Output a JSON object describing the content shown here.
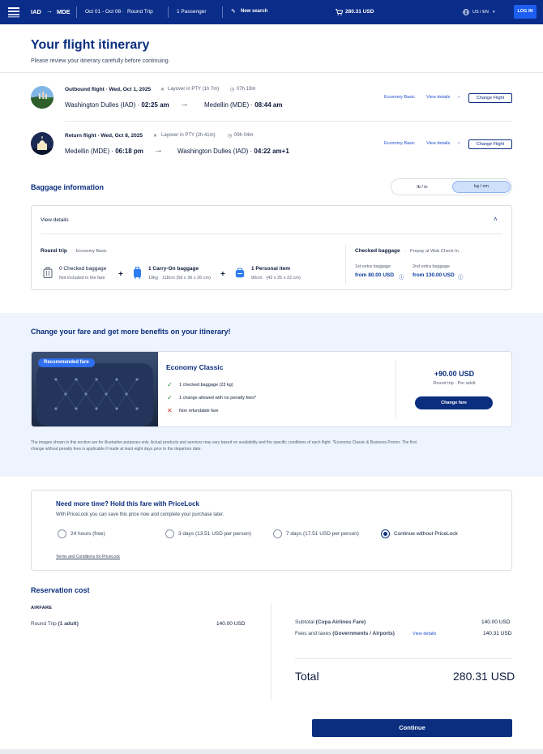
{
  "header": {
    "origin": "IAD",
    "destination": "MDE",
    "dates": "Oct 01 - Oct 08",
    "trip_type": "Round Trip",
    "passengers": "1 Passenger",
    "new_search": "New search",
    "cart_total": "280.31 USD",
    "locale": "US / EN",
    "login": "LOG IN"
  },
  "page": {
    "title": "Your flight itinerary",
    "subtitle": "Please review your itinerary carefully before continuing."
  },
  "flights": [
    {
      "label": "Outbound flight · Wed, Oct 1, 2025",
      "layover": "Layover in PTY (1h 7m)",
      "duration": "07h 19m",
      "from": "Washington Dulles (IAD)",
      "from_time": "02:25 am",
      "to": "Medellin (MDE)",
      "to_time": "08:44 am",
      "fare": "Economy Basic",
      "view_details": "View details",
      "change": "Change Flight"
    },
    {
      "label": "Return flight · Wed, Oct 8, 2025",
      "layover": "Layover in PTY (2h 41m)",
      "duration": "09h 04m",
      "from": "Medellin (MDE)",
      "from_time": "06:18 pm",
      "to": "Washington Dulles (IAD)",
      "to_time": "04:22 am+1",
      "fare": "Economy Basic",
      "view_details": "View details",
      "change": "Change Flight"
    }
  ],
  "baggage": {
    "title": "Baggage information",
    "unit_lb": "lb / in",
    "unit_kg": "kg / cm",
    "view_details": "View details",
    "round_trip": "Round trip",
    "round_trip_fare": "Economy Basic",
    "items": [
      {
        "title": "0 Checked baggage",
        "detail": "Not included in the fare"
      },
      {
        "title": "1 Carry-On baggage",
        "detail": "10kg · 118cm (56 x 36 x 26 cm)"
      },
      {
        "title": "1 Personal item",
        "detail": "90cm · (43 x 25 x 22 cm)"
      }
    ],
    "plus": "+",
    "checked_title": "Checked baggage",
    "checked_note": "Prepay at Web Check-In.",
    "extra1_label": "1st extra baggage",
    "extra1_price": "from 80.00 USD",
    "extra2_label": "2nd extra baggage",
    "extra2_price": "from 130.00 USD"
  },
  "fare_upgrade": {
    "title": "Change your fare and get more benefits on your itinerary!",
    "badge": "Recommended fare",
    "fare_name": "Economy Classic",
    "benefits": [
      {
        "text": "1 checked baggage (23 kg)",
        "included": true
      },
      {
        "text": "1 change allowed with no penalty fees*",
        "included": true
      },
      {
        "text": "Non refundable fare",
        "included": false
      }
    ],
    "price": "+90.00 USD",
    "price_note": "Round trip · Per adult",
    "button": "Change fare",
    "disclaimer_1": "The images shown in this section are for illustrative purposes only. Actual products and services may vary based on availability and the specific conditions of each flight. *Economy Classic & Business Promo: The first",
    "disclaimer_2": "change without penalty fees is applicable if made at least eight days prior to the departure date."
  },
  "pricelock": {
    "title": "Need more time? Hold this fare with PriceLock",
    "subtitle": "With PriceLock you can save this price now and complete your purchase later.",
    "options": [
      {
        "label": "24 hours (free)",
        "selected": false
      },
      {
        "label": "3 days (13.51 USD per person)",
        "selected": false
      },
      {
        "label": "7 days (17.51 USD per person)",
        "selected": false
      },
      {
        "label": "Continue without PriceLock",
        "selected": true
      }
    ],
    "terms": "Terms and Conditions for PriceLock"
  },
  "reservation": {
    "title": "Reservation cost",
    "airfare_heading": "AIRFARE",
    "round_trip_label": "Round Trip",
    "round_trip_qty": "(1 adult)",
    "round_trip_amount": "140.00 USD",
    "subtotal_label": "Subtotal",
    "subtotal_desc": "(Copa Airlines Fare)",
    "subtotal_amount": "140.00 USD",
    "fees_label": "Fees and taxes",
    "fees_desc": "(Governments / Airports)",
    "fees_link": "View details",
    "fees_amount": "140.31 USD",
    "total_label": "Total",
    "total_amount": "280.31 USD"
  },
  "actions": {
    "continue": "Continue"
  },
  "colors": {
    "brand_navy": "#0b2d8a",
    "title_blue": "#0b2e7e",
    "link_blue": "#1f4fd1",
    "fare_bg": "#eef4fd",
    "check_green": "#1f8a3a",
    "cross_red": "#d6342c"
  }
}
